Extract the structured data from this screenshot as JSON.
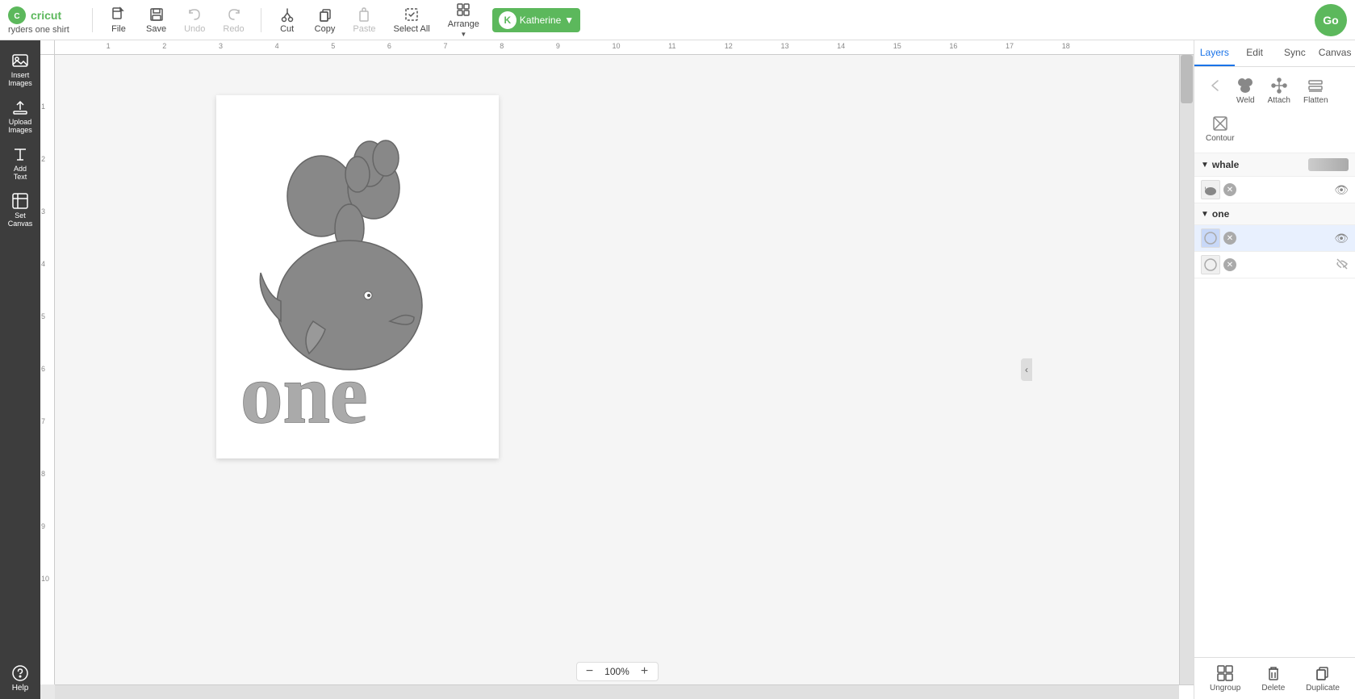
{
  "app": {
    "logo_text": "cricut",
    "project_name": "ryders one shirt"
  },
  "toolbar": {
    "file_label": "File",
    "save_label": "Save",
    "undo_label": "Undo",
    "redo_label": "Redo",
    "cut_label": "Cut",
    "copy_label": "Copy",
    "paste_label": "Paste",
    "select_all_label": "Select All",
    "arrange_label": "Arrange",
    "go_label": "Go"
  },
  "user": {
    "name": "Katherine",
    "badge_color": "#5cb85c"
  },
  "sidebar": {
    "items": [
      {
        "id": "insert-images",
        "icon": "image",
        "label": "Insert\nImages"
      },
      {
        "id": "upload-images",
        "icon": "upload",
        "label": "Upload\nImages"
      },
      {
        "id": "add-text",
        "icon": "text",
        "label": "Add\nText"
      },
      {
        "id": "set-canvas",
        "icon": "canvas",
        "label": "Set\nCanvas"
      }
    ],
    "help_label": "Help"
  },
  "right_panel": {
    "tabs": [
      {
        "id": "layers",
        "label": "Layers",
        "active": true
      },
      {
        "id": "edit",
        "label": "Edit",
        "active": false
      },
      {
        "id": "sync",
        "label": "Sync",
        "active": false
      },
      {
        "id": "canvas",
        "label": "Canvas",
        "active": false
      }
    ],
    "actions": [
      {
        "id": "weld",
        "label": "Weld",
        "icon": "weld"
      },
      {
        "id": "attach",
        "label": "Attach",
        "icon": "attach"
      },
      {
        "id": "flatten",
        "label": "Flatten",
        "icon": "flatten"
      },
      {
        "id": "contour",
        "label": "Contour",
        "icon": "contour"
      }
    ],
    "groups": [
      {
        "id": "whale",
        "label": "whale",
        "expanded": true,
        "items": [
          {
            "id": "whale-item",
            "selected": false,
            "color": "#888",
            "has_eye": true,
            "eye_visible": true
          }
        ]
      },
      {
        "id": "one",
        "label": "one",
        "expanded": true,
        "items": [
          {
            "id": "one-item-1",
            "selected": true,
            "color": "#888",
            "has_eye": true,
            "eye_visible": true
          },
          {
            "id": "one-item-2",
            "selected": false,
            "color": "#888",
            "has_eye": true,
            "eye_visible": false
          }
        ]
      }
    ],
    "bottom_actions": [
      {
        "id": "ungroup",
        "label": "Ungroup",
        "icon": "ungroup"
      },
      {
        "id": "delete",
        "label": "Delete",
        "icon": "delete"
      },
      {
        "id": "duplicate",
        "label": "Duplicate",
        "icon": "duplicate"
      }
    ]
  },
  "canvas": {
    "zoom": "100%",
    "ruler_unit": "in"
  },
  "ruler_h_labels": [
    "1",
    "2",
    "3",
    "4",
    "5",
    "6",
    "7",
    "8",
    "9",
    "10",
    "11",
    "12",
    "13",
    "14",
    "15",
    "16",
    "17",
    "18"
  ],
  "ruler_v_labels": [
    "1",
    "2",
    "3",
    "4",
    "5",
    "6",
    "7",
    "8",
    "9",
    "10"
  ]
}
